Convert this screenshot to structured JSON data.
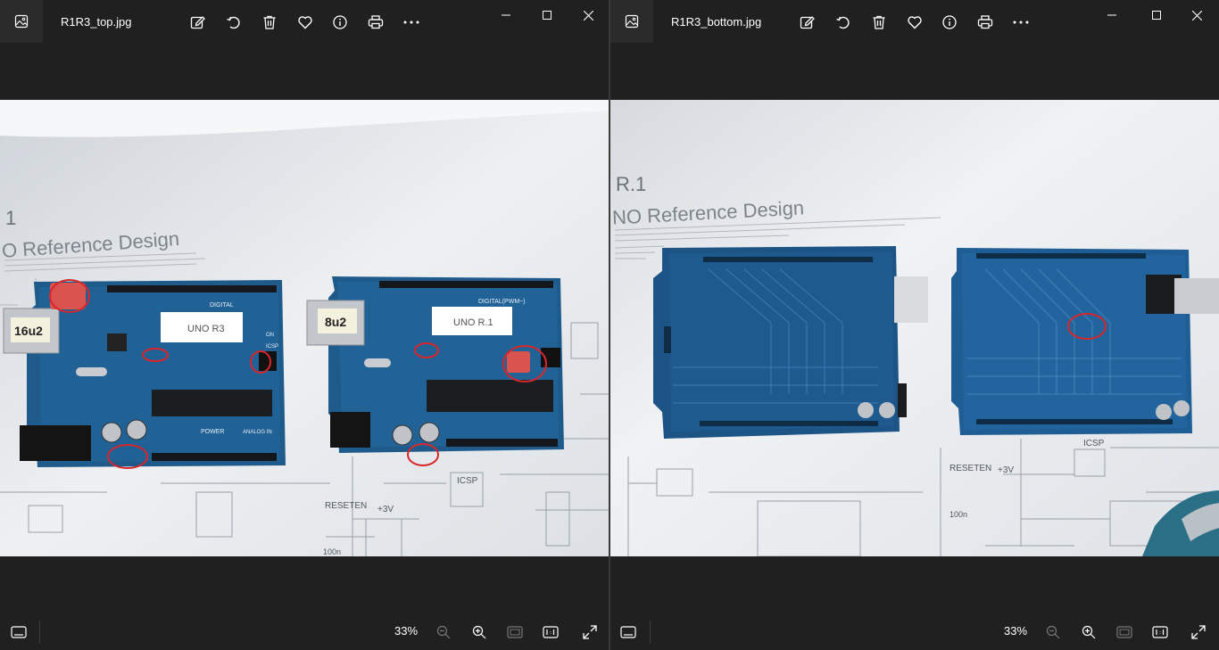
{
  "windows": [
    {
      "id": "left",
      "filename": "R1R3_top.jpg",
      "zoom": "33%",
      "photo": {
        "doc_heading": "O Reference Design",
        "doc_marker": "1",
        "board1_tag": "16u2",
        "board1_label": "UNO R3",
        "board2_tag": "8u2",
        "board2_label": "UNO R.1",
        "silk_digital": "DIGITAL",
        "silk_digital_pwm": "DIGITAL(PWM~)",
        "silk_power": "POWER",
        "silk_analog": "ANALOG IN",
        "silk_on": "ON",
        "silk_icsp": "ICSP",
        "schem_resetn": "RESETEN",
        "schem_3v": "+3V",
        "schem_icsp": "ICSP",
        "schem_100n": "100n"
      }
    },
    {
      "id": "right",
      "filename": "R1R3_bottom.jpg",
      "zoom": "33%",
      "photo": {
        "doc_heading": "NO Reference Design",
        "doc_marker": "R.1",
        "schem_resetn": "RESETEN",
        "schem_3v": "+3V",
        "schem_icsp": "ICSP",
        "schem_100n": "100n"
      }
    }
  ],
  "icons": {
    "app": "photos-app-icon",
    "edit": "edit-image-icon",
    "rotate": "rotate-icon",
    "delete": "delete-icon",
    "favorite": "heart-icon",
    "info": "info-icon",
    "print": "print-icon",
    "more": "more-icon",
    "minimize": "minimize-icon",
    "maximize": "maximize-icon",
    "close": "close-icon",
    "filmstrip": "filmstrip-icon",
    "zoom_out": "zoom-out-icon",
    "zoom_in": "zoom-in-icon",
    "fit": "fit-to-window-icon",
    "actual": "actual-size-icon",
    "fullscreen": "fullscreen-icon"
  },
  "colors": {
    "chrome": "#202020",
    "board": "#1f5a8a",
    "marker": "#d8262a",
    "paper": "#e8ebee"
  }
}
